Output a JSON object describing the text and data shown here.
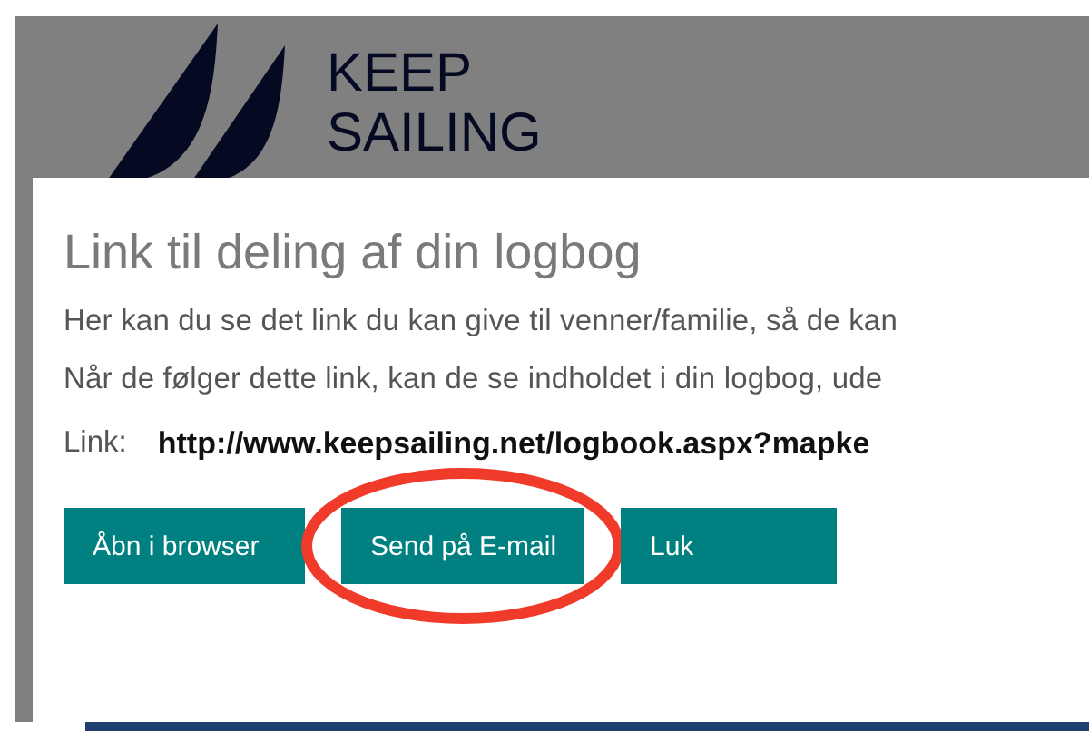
{
  "logo": {
    "line_1": "KEEP",
    "line_2": "SAILING"
  },
  "dialog": {
    "title": "Link til deling af din logbog",
    "paragraphs": [
      "Her kan du se det link du kan give til venner/familie, så de kan",
      "Når de følger dette link, kan de se indholdet i din logbog, ude"
    ],
    "link_label": "Link:",
    "link_value": "http://www.keepsailing.net/logbook.aspx?mapke",
    "buttons": [
      {
        "label": "Åbn i browser",
        "highlighted": false
      },
      {
        "label": "Send på E-mail",
        "highlighted": true
      },
      {
        "label": "Luk",
        "highlighted": false
      }
    ]
  }
}
